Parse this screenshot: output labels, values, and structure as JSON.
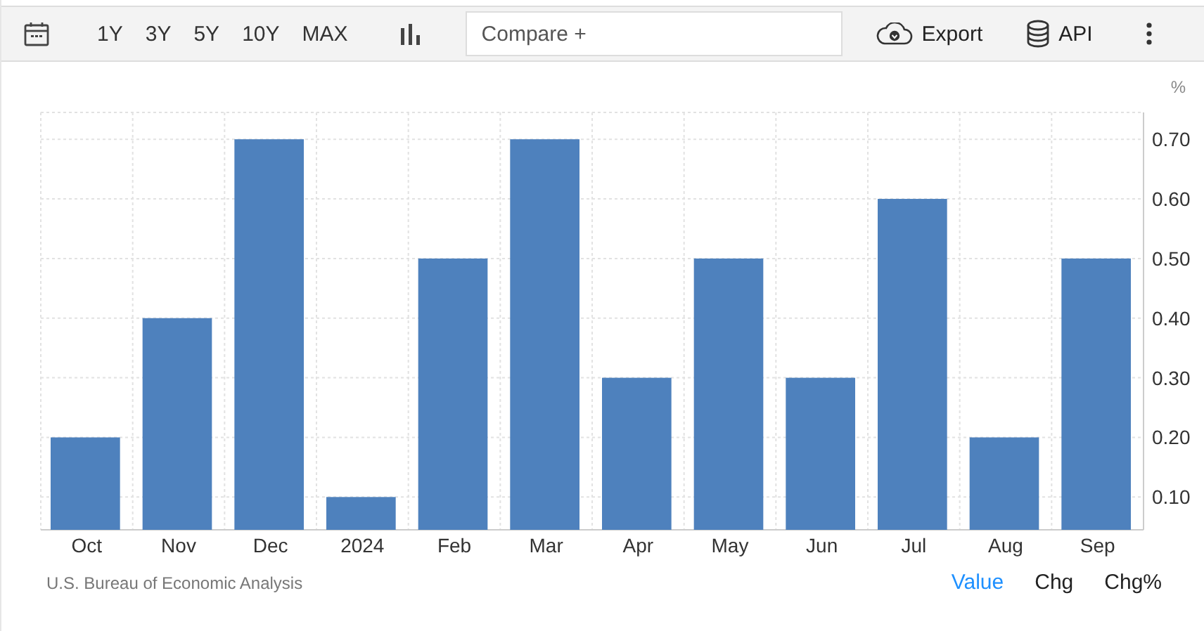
{
  "toolbar": {
    "ranges": [
      {
        "label": "1Y",
        "selected": false
      },
      {
        "label": "3Y",
        "selected": false
      },
      {
        "label": "5Y",
        "selected": false
      },
      {
        "label": "10Y",
        "selected": false
      },
      {
        "label": "MAX",
        "selected": false
      }
    ],
    "compare": {
      "placeholder": "Compare +"
    },
    "export": "Export",
    "api": "API"
  },
  "chart": {
    "unit": "%",
    "chart_data": {
      "type": "bar",
      "categories": [
        "Oct",
        "Nov",
        "Dec",
        "2024",
        "Feb",
        "Mar",
        "Apr",
        "May",
        "Jun",
        "Jul",
        "Aug",
        "Sep"
      ],
      "grid": true,
      "series": [
        {
          "color": "#4e81bd",
          "values": [
            0.2,
            0.4,
            0.7,
            0.1,
            0.5,
            0.7,
            0.3,
            0.5,
            0.3,
            0.6,
            0.2,
            0.5
          ]
        }
      ],
      "ylim": [
        0.045,
        0.745
      ],
      "yticks": [
        {
          "value": 0.1,
          "label": "0.10"
        },
        {
          "value": 0.2,
          "label": "0.20"
        },
        {
          "value": 0.3,
          "label": "0.30"
        },
        {
          "value": 0.4,
          "label": "0.40"
        },
        {
          "value": 0.5,
          "label": "0.50"
        },
        {
          "value": 0.6,
          "label": "0.60"
        },
        {
          "value": 0.7,
          "label": "0.70"
        }
      ]
    }
  },
  "footer": {
    "source": "U.S. Bureau of Economic Analysis",
    "modes": [
      {
        "label": "Value",
        "selected": true
      },
      {
        "label": "Chg",
        "selected": false
      },
      {
        "label": "Chg%",
        "selected": false
      }
    ]
  }
}
